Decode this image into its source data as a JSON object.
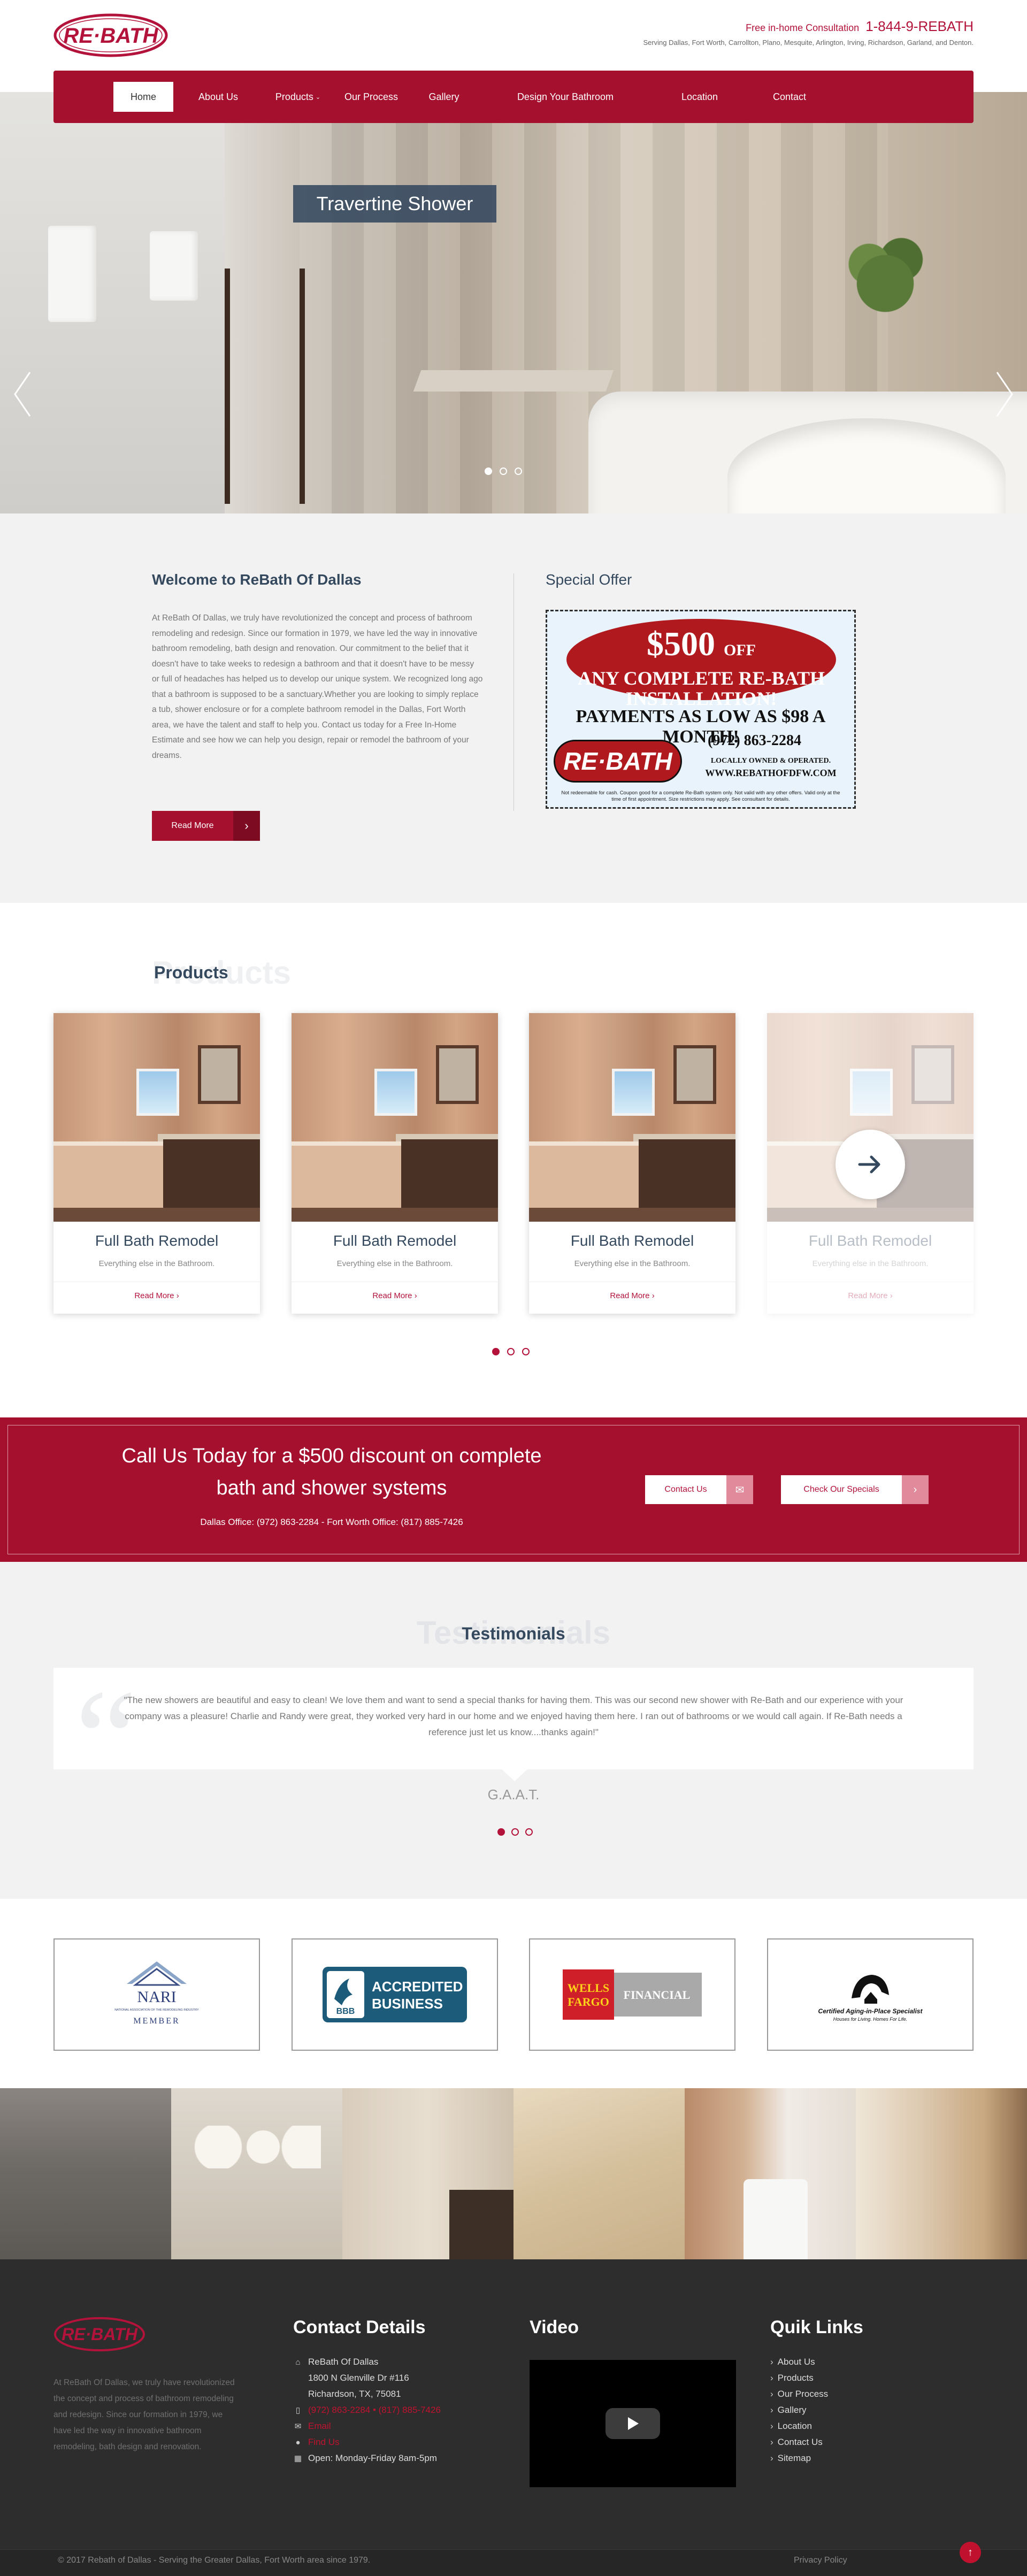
{
  "header": {
    "logo_text": "RE·BATH",
    "consult_label": "Free in-home Consultation",
    "phone": "1-844-9-REBATH",
    "areas": "Serving Dallas, Fort Worth, Carrollton, Plano, Mesquite, Arlington, Irving, Richardson, Garland, and Denton."
  },
  "nav": {
    "items": [
      {
        "label": "Home",
        "active": true
      },
      {
        "label": "About Us"
      },
      {
        "label": "Products",
        "caret": "⌄"
      },
      {
        "label": "Our Process"
      },
      {
        "label": "Gallery"
      },
      {
        "label": "Design Your Bathroom"
      },
      {
        "label": "Location"
      },
      {
        "label": "Contact"
      }
    ]
  },
  "hero": {
    "caption": "Travertine Shower",
    "slide_count": 3,
    "active_slide": 1
  },
  "welcome": {
    "title": "Welcome to ReBath Of Dallas",
    "body": "At ReBath Of Dallas, we truly have revolutionized the concept and process of bathroom remodeling and redesign. Since our formation in 1979, we have led the way in innovative bathroom remodeling, bath design and renovation. Our commitment to the belief that it doesn't have to take weeks to redesign a bathroom and that it doesn't have to be messy or full of headaches has helped us to develop our unique system. We recognized long ago that a bathroom is supposed to be a sanctuary.Whether you are looking to simply replace a tub, shower enclosure or for a complete bathroom remodel in the Dallas, Fort Worth area, we have the talent and staff to help you. Contact us today for a Free In-Home Estimate and see how we can help you design, repair or remodel the bathroom of your dreams.",
    "button_label": "Read More",
    "button_arrow": "›"
  },
  "special": {
    "title": "Special Offer",
    "coupon": {
      "amount": "$500",
      "off": "OFF",
      "line2": "ANY COMPLETE RE-BATH",
      "line3": "INSTALLATION!",
      "payments": "PAYMENTS AS LOW AS $98 A MONTH!",
      "phone": "(972) 863-2284",
      "logo": "RE·BATH",
      "locally": "LOCALLY OWNED & OPERATED.",
      "url": "WWW.REBATHOFDFW.COM",
      "fine": "Not redeemable for cash. Coupon good for a complete Re-Bath system only. Not valid with any other offers. Valid only at the time of first appointment. Size restrictions may apply. See consultant for details."
    }
  },
  "products": {
    "ghost": "Products",
    "title": "Products",
    "items": [
      {
        "name": "Full Bath Remodel",
        "desc": "Everything else in the Bathroom.",
        "more": "Read More",
        "chev": "›"
      },
      {
        "name": "Full Bath Remodel",
        "desc": "Everything else in the Bathroom.",
        "more": "Read More",
        "chev": "›"
      },
      {
        "name": "Full Bath Remodel",
        "desc": "Everything else in the Bathroom.",
        "more": "Read More",
        "chev": "›"
      },
      {
        "name": "Full Bath Remodel",
        "desc": "Everything else in the Bathroom.",
        "more": "Read More",
        "chev": "›"
      }
    ]
  },
  "cta": {
    "heading_line1": "Call Us Today for a $500 discount on complete",
    "heading_line2": "bath and shower systems",
    "offices": "Dallas Office: (972) 863-2284 - Fort Worth Office: (817) 885-7426",
    "contact_label": "Contact Us",
    "contact_icon": "✉",
    "specials_label": "Check Our Specials",
    "specials_icon": "›"
  },
  "testimonials": {
    "ghost": "Testimonials",
    "title": "Testimonials",
    "quote_mark": "“",
    "text": "\"The new showers are beautiful and easy to clean! We love them and want to send a special thanks for having them. This was our second new shower with Re-Bath and our experience with your company was a pleasure! Charlie and Randy were great, they worked very hard in our home and we enjoyed having them here. I ran out of bathrooms or we would call again. If Re-Bath needs a reference just let us know....thanks again!\"",
    "author": "G.A.A.T."
  },
  "partners": {
    "nari": {
      "name": "NARI",
      "sub": "NATIONAL ASSOCIATION OF THE REMODELING INDUSTRY",
      "member": "MEMBER"
    },
    "bbb": {
      "short": "BBB",
      "line1": "ACCREDITED",
      "line2": "BUSINESS"
    },
    "wells": {
      "line1": "WELLS",
      "line2": "FARGO",
      "label": "FINANCIAL"
    },
    "caps": {
      "line1": "Certified Aging-in-Place Specialist",
      "line2": "Houses for Living. Homes For Life."
    }
  },
  "footer": {
    "logo_text": "RE·BATH",
    "about": "At ReBath Of Dallas, we truly have revolutionized the concept and process of bathroom remodeling and redesign. Since our formation in 1979, we have led the way in innovative bathroom remodeling, bath design and renovation.",
    "contact_heading": "Contact Details",
    "company": "ReBath Of Dallas",
    "street": "1800 N Glenville Dr #116",
    "city": "Richardson, TX, 75081",
    "phones": "(972) 863-2284 • (817) 885-7426",
    "email": "Email",
    "map": "Find Us",
    "hours": "Open: Monday-Friday 8am-5pm",
    "video_heading": "Video",
    "links_heading": "Quik Links",
    "links": [
      "About Us",
      "Products",
      "Our Process",
      "Gallery",
      "Location",
      "Contact Us",
      "Sitemap"
    ],
    "copyright": "© 2017 Rebath of Dallas - Serving the Greater Dallas, Fort Worth area since 1979.",
    "privacy": "Privacy Policy"
  },
  "colors": {
    "brand_red": "#a5102e",
    "navy": "#34485e",
    "footer_bg": "#2d2d2d"
  }
}
